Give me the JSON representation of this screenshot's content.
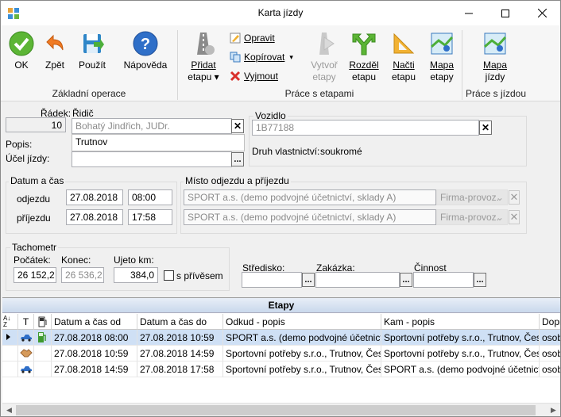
{
  "window": {
    "title": "Karta jízdy"
  },
  "ribbon": {
    "basic": {
      "group_label": "Základní operace",
      "ok": "OK",
      "back": "Zpět",
      "apply": "Použít",
      "help": "Nápověda"
    },
    "stages": {
      "group_label": "Práce s etapami",
      "add_line1": "Přidat",
      "add_line2": "etapu",
      "edit": "Opravit",
      "copy": "Kopírovat",
      "delete": "Vyjmout",
      "create_line1": "Vytvoř",
      "create_line2": "etapy",
      "split_line1": "Rozděl",
      "split_line2": "etapu",
      "load_line1": "Načti",
      "load_line2": "etapu",
      "map_line1": "Mapa",
      "map_line2": "etapy"
    },
    "trip": {
      "group_label": "Práce s jízdou",
      "map_line1": "Mapa",
      "map_line2": "jízdy"
    }
  },
  "form": {
    "row_label": "Řádek:",
    "row_value": "10",
    "driver_label": "Řidič",
    "driver_value": "Bohatý Jindřich, JUDr.",
    "description_label": "Popis:",
    "description_value": "Trutnov",
    "purpose_label": "Účel jízdy:",
    "purpose_value": "",
    "vehicle_label": "Vozidlo",
    "vehicle_value": "1B77188",
    "ownership_label": "Druh vlastnictví:",
    "ownership_value": "soukromé",
    "datetime_legend": "Datum a čas",
    "departure_label": "odjezdu",
    "departure_date": "27.08.2018",
    "departure_time": "08:00",
    "arrival_label": "příjezdu",
    "arrival_date": "27.08.2018",
    "arrival_time": "17:58",
    "place_legend": "Místo odjezdu a příjezdu",
    "departure_place": "SPORT a.s. (demo podvojné účetnictví, sklady A)",
    "departure_place_type": "Firma-provoz.",
    "arrival_place": "SPORT a.s. (demo podvojné účetnictví, sklady A)",
    "arrival_place_type": "Firma-provoz.",
    "tacho_legend": "Tachometr",
    "tacho_start_label": "Počátek:",
    "tacho_start_value": "26 152,2",
    "tacho_end_label": "Konec:",
    "tacho_end_value": "26 536,2",
    "km_label": "Ujeto km:",
    "km_value": "384,0",
    "trailer_label": "s přívěsem",
    "center_label": "Středisko:",
    "order_label": "Zakázka:",
    "activity_label": "Činnost"
  },
  "grid": {
    "title": "Etapy",
    "columns": [
      "T",
      "Datum a čas od",
      "Datum a čas do",
      "Odkud - popis",
      "Kam - popis",
      "Dopr"
    ],
    "rows": [
      {
        "type_icon": "car-icon",
        "fuel_icon": "fuel-pump-icon",
        "from": "27.08.2018  08:00",
        "to": "27.08.2018  10:59",
        "origin": "SPORT a.s. (demo podvojné účetnictví, s",
        "destination": "Sportovní potřeby s.r.o., Trutnov, Česká",
        "extra": "osobn"
      },
      {
        "type_icon": "handshake-icon",
        "fuel_icon": "",
        "from": "27.08.2018  10:59",
        "to": "27.08.2018  14:59",
        "origin": "Sportovní potřeby s.r.o., Trutnov, Česká",
        "destination": "Sportovní potřeby s.r.o., Trutnov, Česká",
        "extra": "osobn"
      },
      {
        "type_icon": "car-icon",
        "fuel_icon": "",
        "from": "27.08.2018  14:59",
        "to": "27.08.2018  17:58",
        "origin": "Sportovní potřeby s.r.o., Trutnov, Česká",
        "destination": "SPORT a.s. (demo podvojné účetnictví, s",
        "extra": "osobn"
      }
    ]
  }
}
